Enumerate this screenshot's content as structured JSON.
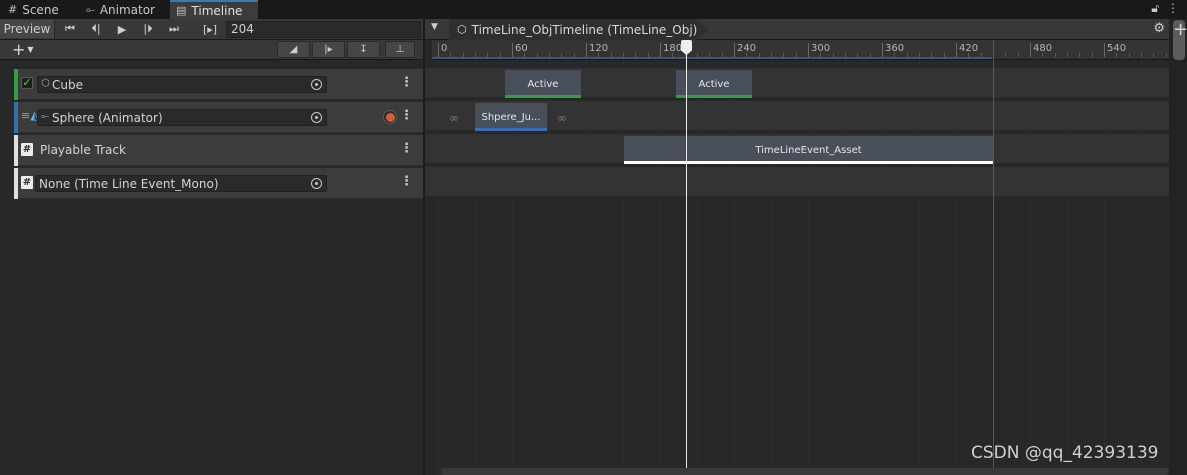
{
  "tabs": [
    {
      "label": "Scene",
      "icon": "grid-icon"
    },
    {
      "label": "Animator",
      "icon": "animator-icon"
    },
    {
      "label": "Timeline",
      "icon": "film-icon"
    }
  ],
  "toolbar": {
    "preview_label": "Preview",
    "frame_value": "204",
    "frame_prefix": "[▸]"
  },
  "breadcrumb": {
    "label": "TimeLine_ObjTimeline (TimeLine_Obj)"
  },
  "ruler": {
    "ticks": [
      "0",
      "60",
      "120",
      "180",
      "240",
      "300",
      "360",
      "420",
      "480",
      "540"
    ]
  },
  "tracks": [
    {
      "name": "Cube",
      "type": "activation",
      "color": "#2ea043",
      "has_checkbox": true,
      "checked": true
    },
    {
      "name": "Sphere (Animator)",
      "type": "animation",
      "color": "#3a6db5",
      "has_record": true
    },
    {
      "name": "Playable Track",
      "type": "playable",
      "color": "#e0e0e0"
    },
    {
      "name": "None (Time Line Event_Mono)",
      "type": "signal",
      "color": "#e0e0e0"
    }
  ],
  "clips": {
    "cube_clip_1": "Active",
    "cube_clip_2": "Active",
    "sphere_clip": "Shpere_Ju...",
    "playable_clip": "TimeLineEvent_Asset"
  },
  "playhead_frame": 204,
  "timeline_end_frame": 477,
  "watermark": "CSDN @qq_42393139",
  "colors": {
    "accent_blue": "#3a79bb",
    "activation_green": "#2ea043",
    "animation_blue": "#3a6db5",
    "record_red": "#d45b3e"
  }
}
